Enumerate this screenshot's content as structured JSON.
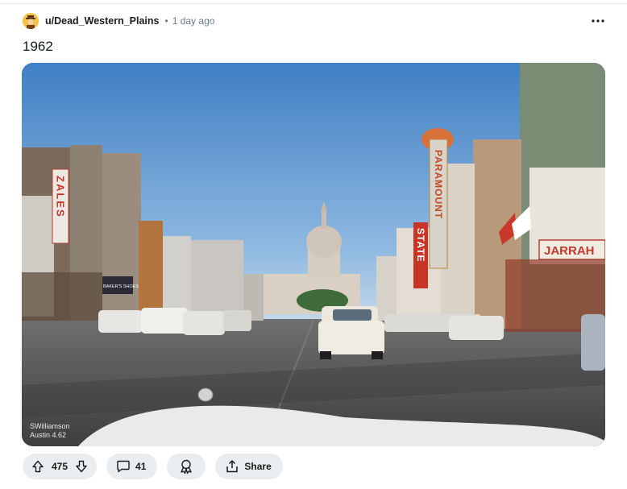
{
  "post": {
    "author": "u/Dead_Western_Plains",
    "separator": "•",
    "time_ago": "1 day ago",
    "title": "1962",
    "avatar_color": "#f6c24a"
  },
  "media": {
    "watermark_line1": "SWilliamson",
    "watermark_line2": "Austin 4.62",
    "signs": {
      "zales": "ZALES",
      "paramount": "PARAMOUNT",
      "state": "STATE",
      "jarrah": "JARRAH",
      "bakers": "BAKER'S SHOES"
    }
  },
  "actions": {
    "upvotes": "475",
    "comments": "41",
    "share_label": "Share"
  },
  "icons": {
    "more": "ellipsis-icon",
    "upvote": "arrow-up-icon",
    "downvote": "arrow-down-icon",
    "comment": "speech-bubble-icon",
    "award": "award-ribbon-icon",
    "share": "share-icon"
  },
  "colors": {
    "pill_bg": "#e9edef",
    "meta_text": "#6b7a80",
    "sky": "#4a86c8"
  }
}
